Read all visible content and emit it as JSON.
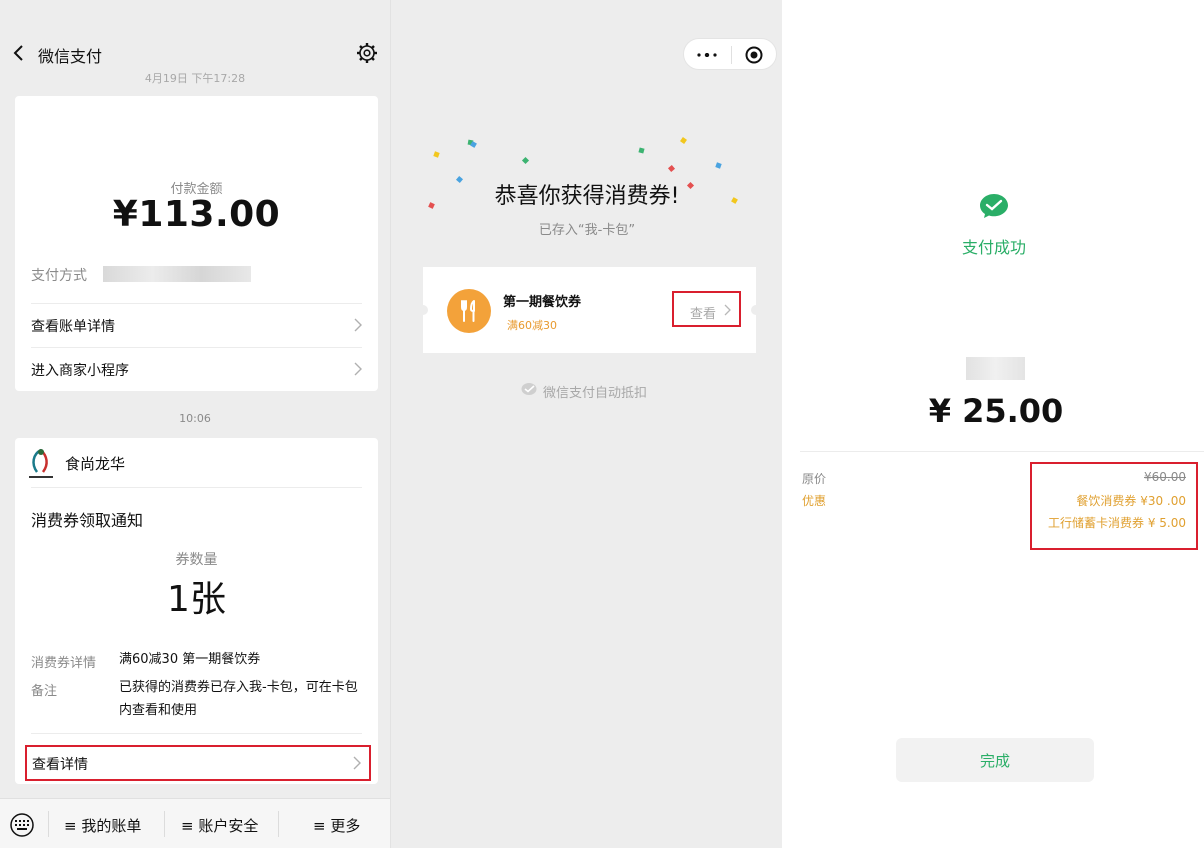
{
  "panel1": {
    "header_title": "微信支付",
    "timestamp_top": "4月19日 下午17:28",
    "payment_card": {
      "amount_label": "付款金额",
      "amount": "¥113.00",
      "method_label": "支付方式",
      "row1": "查看账单详情",
      "row2": "进入商家小程序"
    },
    "timestamp_mid": "10:06",
    "notice_card": {
      "merchant_name": "食尚龙华",
      "title": "消费券领取通知",
      "qty_label": "券数量",
      "qty_value": "1张",
      "detail_key": "消费券详情",
      "detail_val": "满60减30  第一期餐饮券",
      "remark_key": "备注",
      "remark_val": "已获得的消费券已存入我-卡包，可在卡包内查看和使用",
      "view_detail": "查看详情"
    },
    "bottom_menu": [
      "≡ 我的账单",
      "≡ 账户安全",
      "≡ 更多"
    ]
  },
  "panel2": {
    "congrats": "恭喜你获得消费券!",
    "saved_to": "已存入“我-卡包”",
    "coupon_name": "第一期餐饮券",
    "coupon_condition": "满60减30",
    "view_label": "查看",
    "auto_deduct": "微信支付自动抵扣"
  },
  "panel3": {
    "status": "支付成功",
    "amount": "¥ 25.00",
    "orig_label": "原价",
    "orig_price": "¥60.00",
    "discount_label": "优惠",
    "discount1": "餐饮消费券 ¥30 .00",
    "discount2": "工行储蓄卡消费券 ¥ 5.00",
    "done_label": "完成"
  },
  "colors": {
    "wechat_green": "#2aae67",
    "highlight_red": "#d91f2e",
    "coupon_orange": "#f3a23a",
    "discount_gold": "#e0a030"
  }
}
